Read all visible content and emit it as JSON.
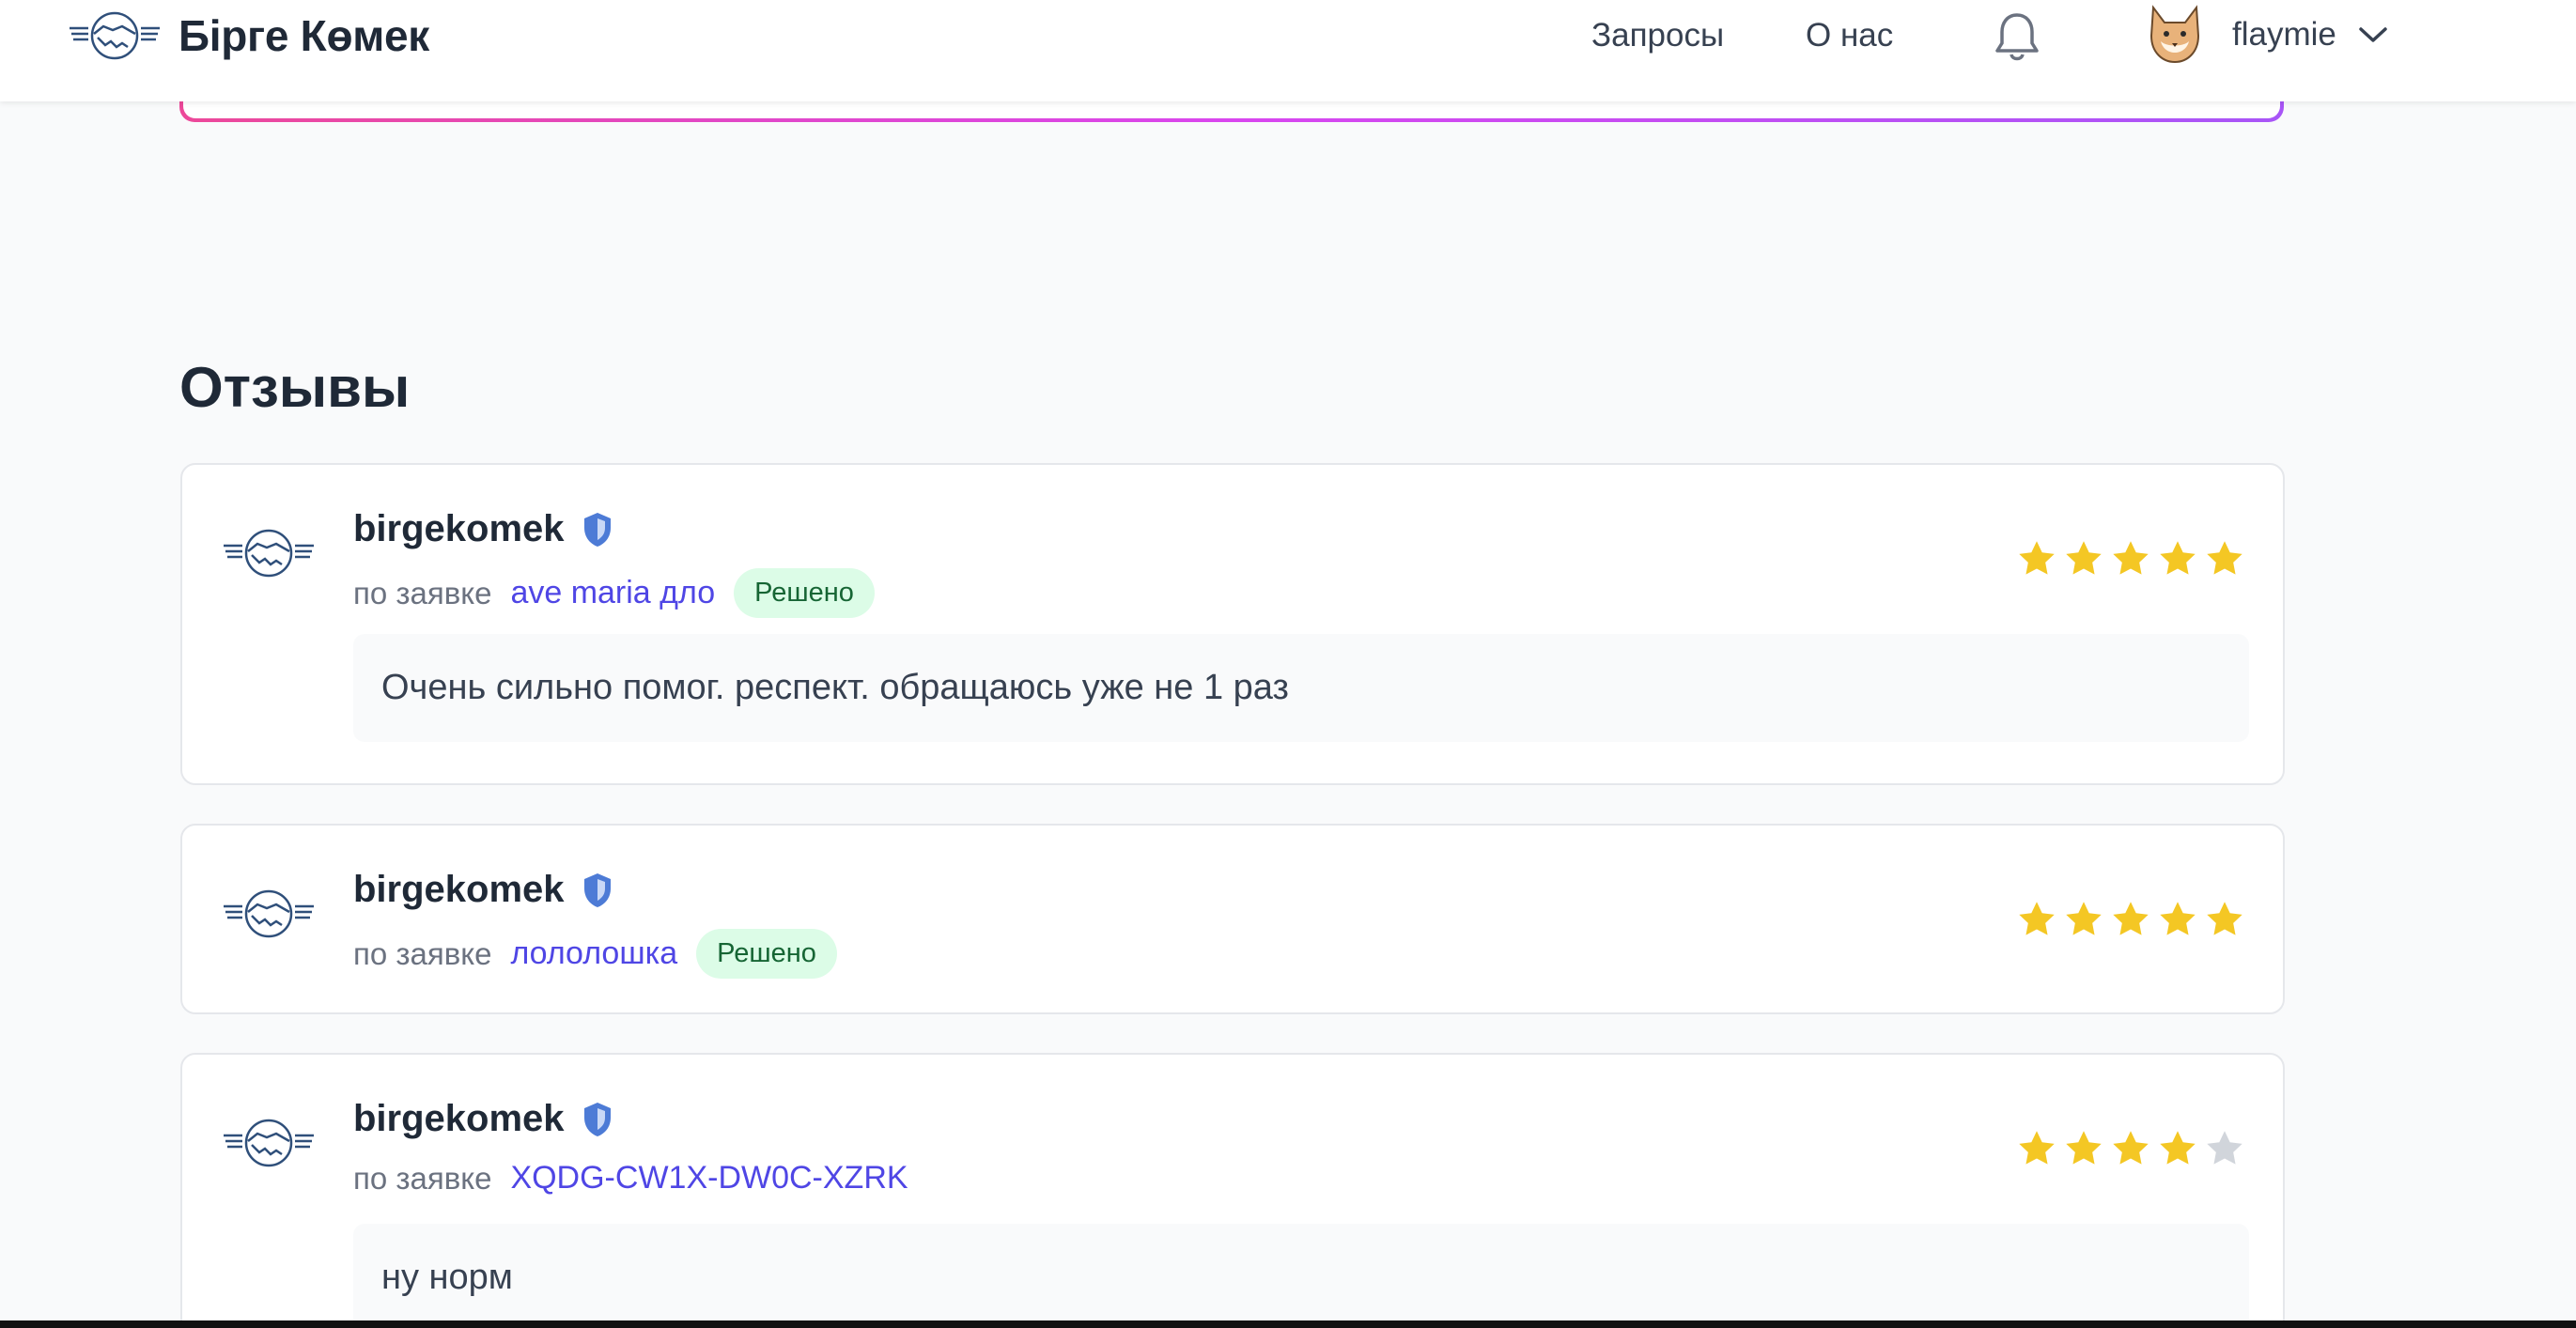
{
  "header": {
    "brand": "Бірге Көмек",
    "nav": {
      "requests": "Запросы",
      "about": "О нас"
    },
    "user": {
      "name": "flaymie"
    }
  },
  "reviews_section": {
    "title": "Отзывы",
    "items": [
      {
        "author": "birgekomek",
        "prefix": "по заявке",
        "request": "ave maria дло",
        "status": "Решено",
        "rating": 5,
        "comment": "Очень сильно помог. респект. обращаюсь уже не 1 раз"
      },
      {
        "author": "birgekomek",
        "prefix": "по заявке",
        "request": "лололошка",
        "status": "Решено",
        "rating": 5,
        "comment": ""
      },
      {
        "author": "birgekomek",
        "prefix": "по заявке",
        "request": "XQDG-CW1X-DW0C-XZRK",
        "status": "",
        "rating": 4,
        "comment": "ну норм"
      }
    ]
  },
  "colors": {
    "accent": "#4f46e5",
    "star_filled": "#f4c724",
    "star_empty": "#d1d5db",
    "badge_bg": "#dcfce7",
    "badge_text": "#166534"
  }
}
